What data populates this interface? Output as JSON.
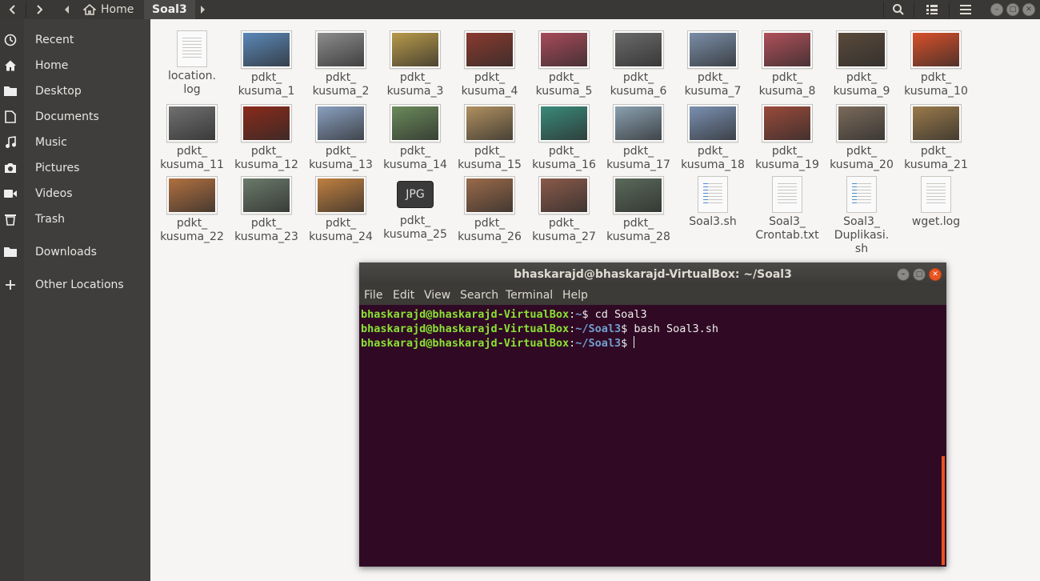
{
  "header": {
    "breadcrumbs": [
      {
        "label": "Home"
      },
      {
        "label": "Soal3"
      }
    ]
  },
  "sidebar": {
    "items": [
      {
        "label": "Recent",
        "icon": "clock-icon"
      },
      {
        "label": "Home",
        "icon": "home-icon"
      },
      {
        "label": "Desktop",
        "icon": "folder-icon"
      },
      {
        "label": "Documents",
        "icon": "document-icon"
      },
      {
        "label": "Music",
        "icon": "music-icon"
      },
      {
        "label": "Pictures",
        "icon": "camera-icon"
      },
      {
        "label": "Videos",
        "icon": "video-icon"
      },
      {
        "label": "Trash",
        "icon": "trash-icon"
      },
      {
        "label": "Downloads",
        "icon": "folder-icon"
      },
      {
        "label": "Other Locations",
        "icon": "plus-icon"
      }
    ]
  },
  "files": [
    {
      "name": "location.\nlog",
      "kind": "text",
      "color": ""
    },
    {
      "name": "pdkt_\nkusuma_1",
      "kind": "image",
      "color": "#5b88b8"
    },
    {
      "name": "pdkt_\nkusuma_2",
      "kind": "image",
      "color": "#8c8c8c"
    },
    {
      "name": "pdkt_\nkusuma_3",
      "kind": "image",
      "color": "#b89a4a"
    },
    {
      "name": "pdkt_\nkusuma_4",
      "kind": "image",
      "color": "#8a3a2e"
    },
    {
      "name": "pdkt_\nkusuma_5",
      "kind": "image",
      "color": "#a84a5a"
    },
    {
      "name": "pdkt_\nkusuma_6",
      "kind": "image",
      "color": "#6a6a6a"
    },
    {
      "name": "pdkt_\nkusuma_7",
      "kind": "image",
      "color": "#7a8ea8"
    },
    {
      "name": "pdkt_\nkusuma_8",
      "kind": "image",
      "color": "#b0505a"
    },
    {
      "name": "pdkt_\nkusuma_9",
      "kind": "image",
      "color": "#5a4a3a"
    },
    {
      "name": "pdkt_\nkusuma_10",
      "kind": "image",
      "color": "#d8502a"
    },
    {
      "name": "pdkt_\nkusuma_11",
      "kind": "image",
      "color": "#707070"
    },
    {
      "name": "pdkt_\nkusuma_12",
      "kind": "image",
      "color": "#8a2a1a"
    },
    {
      "name": "pdkt_\nkusuma_13",
      "kind": "image",
      "color": "#8aa0c0"
    },
    {
      "name": "pdkt_\nkusuma_14",
      "kind": "image",
      "color": "#6a8a5a"
    },
    {
      "name": "pdkt_\nkusuma_15",
      "kind": "image",
      "color": "#b09060"
    },
    {
      "name": "pdkt_\nkusuma_16",
      "kind": "image",
      "color": "#3a8a7a"
    },
    {
      "name": "pdkt_\nkusuma_17",
      "kind": "image",
      "color": "#8aa0b0"
    },
    {
      "name": "pdkt_\nkusuma_18",
      "kind": "image",
      "color": "#7a90b0"
    },
    {
      "name": "pdkt_\nkusuma_19",
      "kind": "image",
      "color": "#9a4a3a"
    },
    {
      "name": "pdkt_\nkusuma_20",
      "kind": "image",
      "color": "#7a6a5a"
    },
    {
      "name": "pdkt_\nkusuma_21",
      "kind": "image",
      "color": "#9a7a4a"
    },
    {
      "name": "pdkt_\nkusuma_22",
      "kind": "image",
      "color": "#b07040"
    },
    {
      "name": "pdkt_\nkusuma_23",
      "kind": "image",
      "color": "#6a7a6a"
    },
    {
      "name": "pdkt_\nkusuma_24",
      "kind": "image",
      "color": "#c08040"
    },
    {
      "name": "pdkt_\nkusuma_25",
      "kind": "jpg",
      "color": ""
    },
    {
      "name": "pdkt_\nkusuma_26",
      "kind": "image",
      "color": "#9a6a4a"
    },
    {
      "name": "pdkt_\nkusuma_27",
      "kind": "image",
      "color": "#8a5a4a"
    },
    {
      "name": "pdkt_\nkusuma_28",
      "kind": "image",
      "color": "#5a6a5a"
    },
    {
      "name": "Soal3.sh",
      "kind": "code",
      "color": ""
    },
    {
      "name": "Soal3_\nCrontab.txt",
      "kind": "text",
      "color": ""
    },
    {
      "name": "Soal3_\nDuplikasi.\nsh",
      "kind": "code",
      "color": ""
    },
    {
      "name": "wget.log",
      "kind": "text",
      "color": ""
    }
  ],
  "jpg_label": "JPG",
  "terminal": {
    "title": "bhaskarajd@bhaskarajd-VirtualBox: ~/Soal3",
    "menu": [
      "File",
      "Edit",
      "View",
      "Search",
      "Terminal",
      "Help"
    ],
    "lines": [
      {
        "user": "bhaskarajd@bhaskarajd-VirtualBox",
        "sep": ":",
        "path": "~",
        "cmd": "$ cd Soal3"
      },
      {
        "user": "bhaskarajd@bhaskarajd-VirtualBox",
        "sep": ":",
        "path": "~/Soal3",
        "cmd": "$ bash Soal3.sh"
      },
      {
        "user": "bhaskarajd@bhaskarajd-VirtualBox",
        "sep": ":",
        "path": "~/Soal3",
        "cmd": "$ "
      }
    ]
  }
}
